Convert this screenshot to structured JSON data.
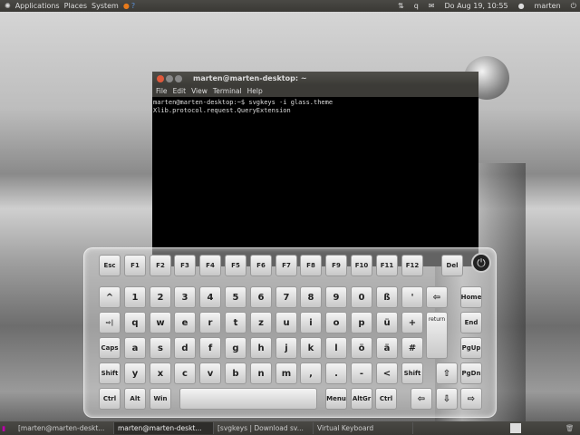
{
  "top_panel": {
    "menus": [
      "Applications",
      "Places",
      "System"
    ],
    "clock": "Do Aug 19, 10:55",
    "user": "marten",
    "tray_text": "q"
  },
  "terminal": {
    "title": "marten@marten-desktop: ~",
    "menu": [
      "File",
      "Edit",
      "View",
      "Terminal",
      "Help"
    ],
    "lines": [
      "marten@marten-desktop:~$ svgkeys -i glass.theme",
      "Xlib.protocol.request.QueryExtension"
    ]
  },
  "keyboard": {
    "keys": [
      [
        "Esc",
        "F1",
        "F2",
        "F3",
        "F4",
        "F5",
        "F6",
        "F7",
        "F8",
        "F9",
        "F10",
        "F11",
        "F12",
        "Del"
      ],
      [
        "^",
        "1",
        "2",
        "3",
        "4",
        "5",
        "6",
        "7",
        "8",
        "9",
        "0",
        "ß",
        "'",
        "⇦",
        "Home"
      ],
      [
        "⇨|",
        "q",
        "w",
        "e",
        "r",
        "t",
        "z",
        "u",
        "i",
        "o",
        "p",
        "ü",
        "+",
        "return",
        "End"
      ],
      [
        "Caps",
        "a",
        "s",
        "d",
        "f",
        "g",
        "h",
        "j",
        "k",
        "l",
        "ö",
        "ä",
        "#",
        "PgUp"
      ],
      [
        "Shift",
        "y",
        "x",
        "c",
        "v",
        "b",
        "n",
        "m",
        ",",
        ".",
        "-",
        "<",
        "Shift",
        "⇧",
        "PgDn"
      ],
      [
        "Ctrl",
        "Alt",
        "Win",
        "",
        "Menu",
        "AltGr",
        "Ctrl",
        "⇦",
        "⇩",
        "⇨"
      ]
    ],
    "power": "⏻"
  },
  "taskbar": {
    "tasks": [
      "[marten@marten-deskt...",
      "marten@marten-deskt...",
      "[svgkeys | Download sv...",
      "Virtual Keyboard"
    ]
  }
}
